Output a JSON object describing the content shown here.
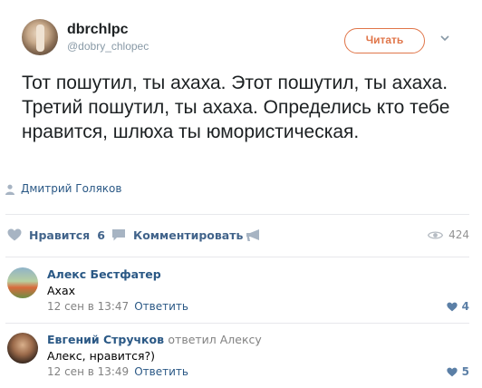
{
  "tweet": {
    "display_name": "dbrchlpc",
    "handle": "@dobry_chlopec",
    "follow_label": "Читать",
    "text": "Тот пошутил, ты ахаха. Этот пошутил, ты ахаха. Третий пошутил, ты ахаха. Определись кто тебе нравится, шлюха ты юмористическая."
  },
  "post": {
    "author": "Дмитрий Голяков",
    "like_label": "Нравится",
    "like_count": "6",
    "comment_label": "Комментировать",
    "views": "424"
  },
  "comments": [
    {
      "author": "Алекс Бестфатер",
      "replied_to": "",
      "text": "Ахах",
      "time": "12 сен в 13:47",
      "reply_label": "Ответить",
      "likes": "4"
    },
    {
      "author": "Евгений Стручков",
      "replied_to": "ответил Алексу",
      "text": "Алекс, нравится?)",
      "time": "12 сен в 13:49",
      "reply_label": "Ответить",
      "likes": "5"
    }
  ],
  "colors": {
    "link": "#2a5885",
    "follow_accent": "#e0764a",
    "icon": "#a7b4c3"
  }
}
